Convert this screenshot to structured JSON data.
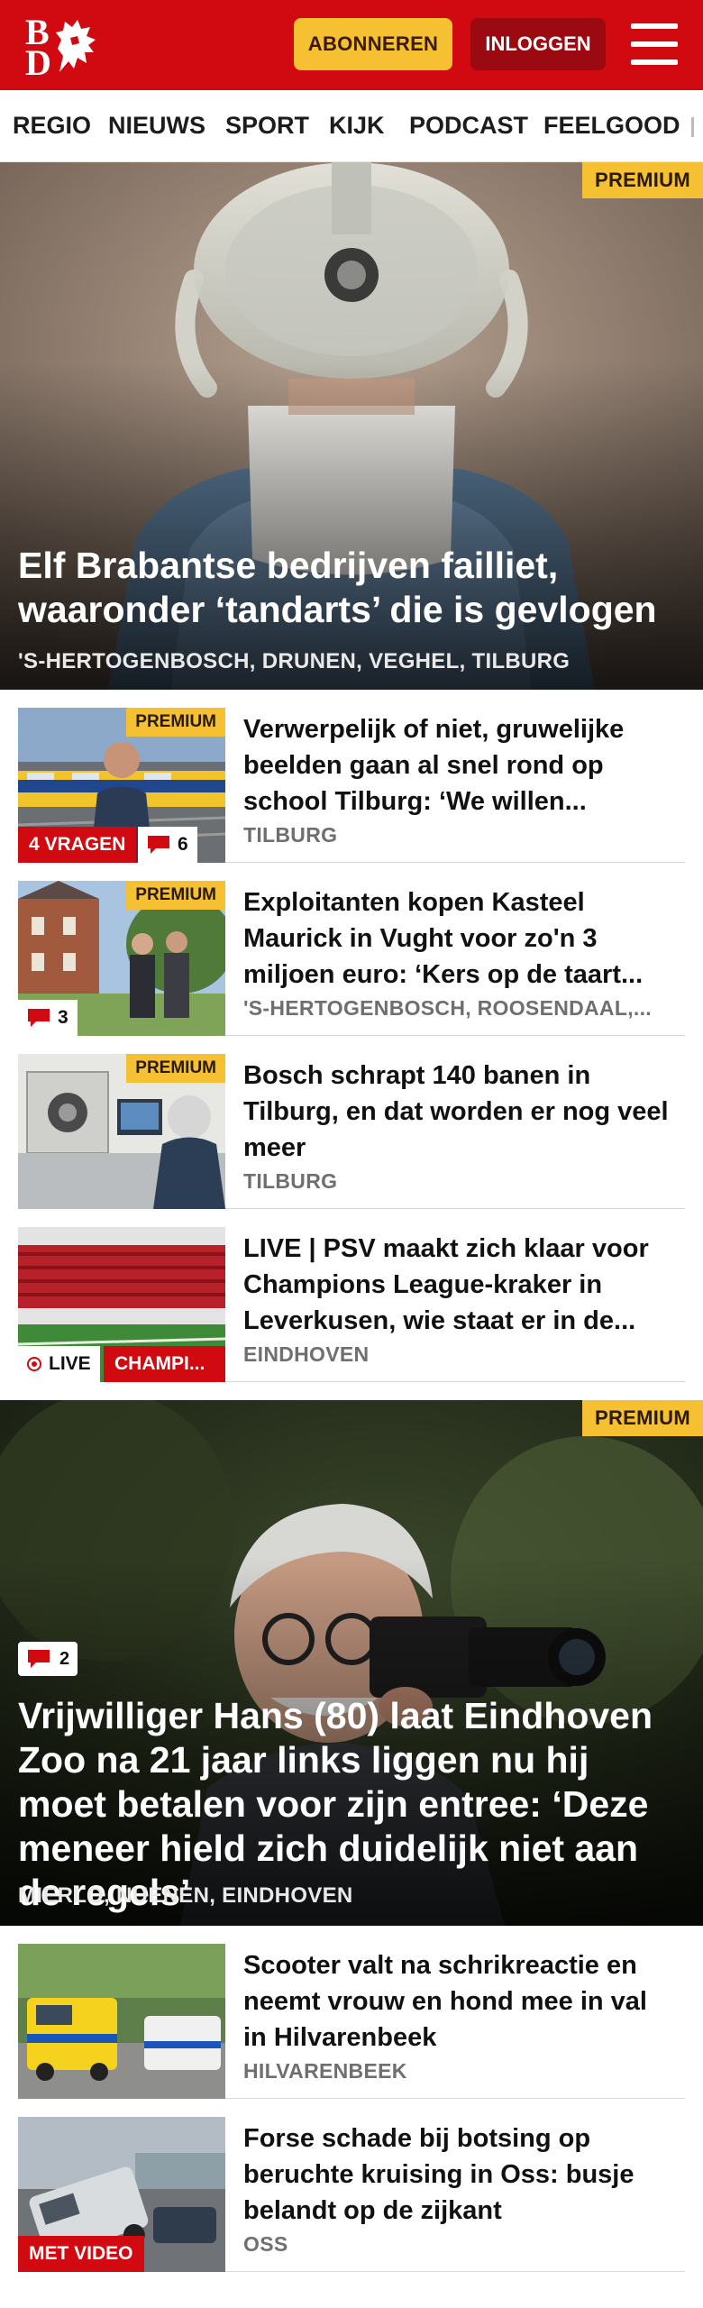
{
  "header": {
    "logo_letters": [
      "B",
      "D"
    ],
    "subscribe_label": "ABONNEREN",
    "login_label": "INLOGGEN",
    "menu_icon": "hamburger-menu-icon",
    "brand_color": "#d10a11",
    "accent_color": "#f6c033"
  },
  "nav": {
    "items": [
      "REGIO",
      "NIEUWS",
      "SPORT",
      "KIJK",
      "PODCAST",
      "FEELGOOD"
    ]
  },
  "hero1": {
    "badge": "PREMIUM",
    "title": "Elf Brabantse bedrijven failliet, waaronder ‘tandarts’ die is gevlogen",
    "location": "'S-HERTOGENBOSCH, DRUNEN, VEGHEL, TILBURG"
  },
  "articles": [
    {
      "premium": "PREMIUM",
      "title": "Verwerpelijk of niet, gruwelijke beelden gaan al snel rond op school Tilburg: ‘We willen...",
      "location": "TILBURG",
      "tag": "4 VRAGEN",
      "comments": "6"
    },
    {
      "premium": "PREMIUM",
      "title": "Exploitanten kopen Kasteel Maurick in Vught voor zo'n 3 miljoen euro: ‘Kers op de taart...",
      "location": "'S-HERTOGENBOSCH, ROOSENDAAL,...",
      "comments": "3"
    },
    {
      "premium": "PREMIUM",
      "title": "Bosch schrapt 140 banen in Tilburg, en dat worden er nog veel meer",
      "location": "TILBURG"
    },
    {
      "title": "LIVE | PSV maakt zich klaar voor Champions League-kraker in Leverkusen, wie staat er in de...",
      "location": "EINDHOVEN",
      "live_label": "LIVE",
      "tag": "CHAMPI..."
    }
  ],
  "hero2": {
    "badge": "PREMIUM",
    "comments": "2",
    "title": "Vrijwilliger Hans (80) laat Eindhoven Zoo na 21 jaar links liggen nu hij moet betalen voor zijn entree: ‘Deze meneer hield zich duidelijk niet aan de regels’",
    "location": "MIERLO, NUENEN, EINDHOVEN"
  },
  "articles2": [
    {
      "title": "Scooter valt na schrikreactie en neemt vrouw en hond mee in val in Hilvarenbeek",
      "location": "HILVARENBEEK"
    },
    {
      "title": "Forse schade bij botsing op beruchte kruising in Oss: busje belandt op de zijkant",
      "location": "OSS",
      "tag": "MET VIDEO"
    }
  ]
}
